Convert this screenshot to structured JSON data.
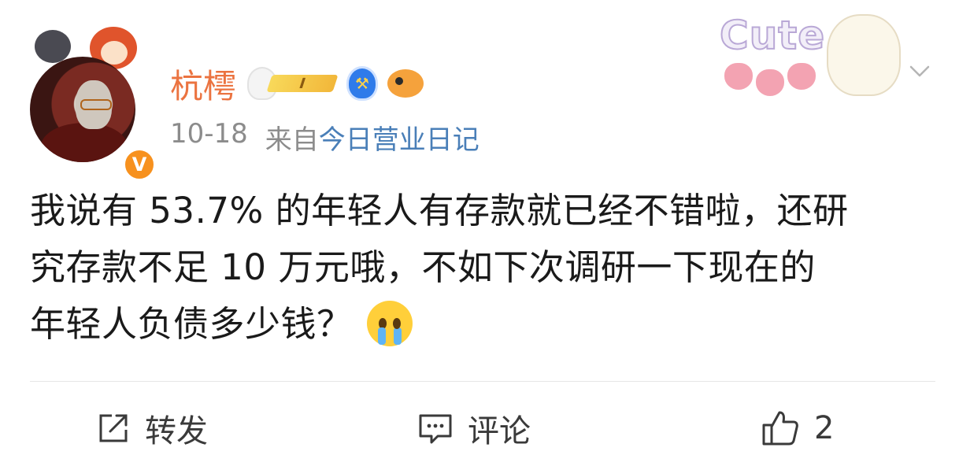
{
  "post": {
    "author": {
      "name": "杭樗",
      "verified_mark": "V",
      "vip_level": "I"
    },
    "meta": {
      "date": "10-18",
      "source_label": "来自",
      "source_app": "今日营业日记"
    },
    "sticker_text": "Cute",
    "body_lines": [
      "我说有 53.7% 的年轻人有存款就已经不错啦，还研",
      "究存款不足 10 万元哦，不如下次调研一下现在的",
      "年轻人负债多少钱？"
    ],
    "emoji": "crying-face-icon"
  },
  "actions": {
    "repost_label": "转发",
    "comment_label": "评论",
    "like_count": "2"
  },
  "colors": {
    "username": "#eb7340",
    "source_link": "#4a7fb8",
    "meta_gray": "#8c8c8c",
    "verified_orange": "#f7911e"
  }
}
